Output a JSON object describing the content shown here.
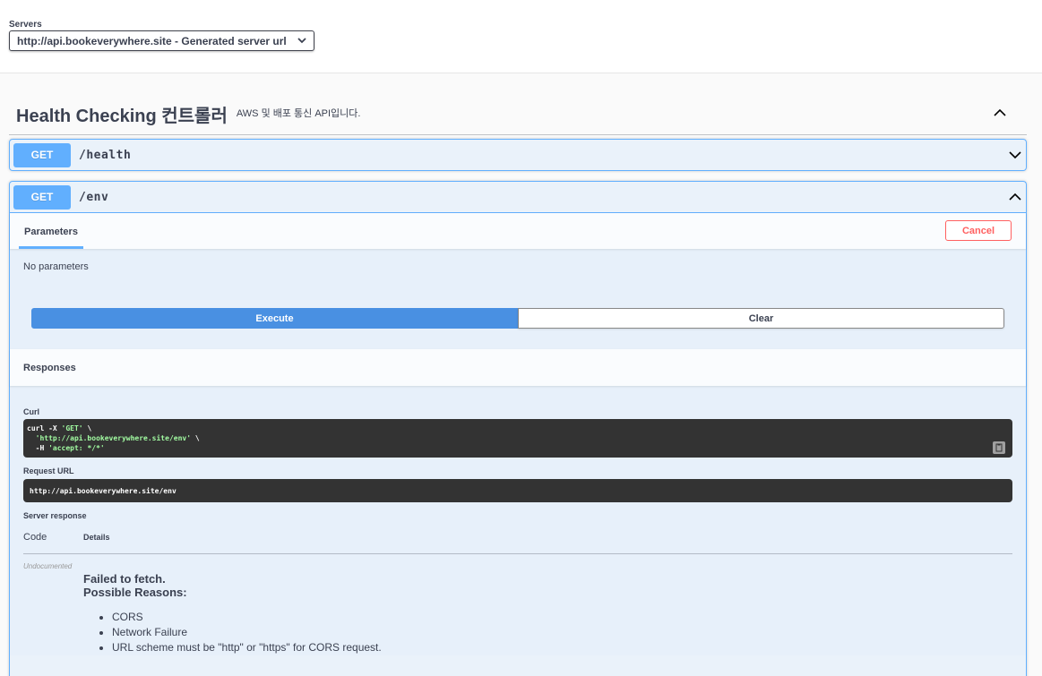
{
  "servers": {
    "label": "Servers",
    "selected": "http://api.bookeverywhere.site - Generated server url"
  },
  "tag": {
    "title": "Health Checking 컨트롤러",
    "description": "AWS 및 배포 통신 API입니다."
  },
  "operations": [
    {
      "method": "GET",
      "path": "/health",
      "expanded": false
    },
    {
      "method": "GET",
      "path": "/env",
      "expanded": true
    }
  ],
  "op_detail": {
    "parameters_tab": "Parameters",
    "cancel_label": "Cancel",
    "no_params": "No parameters",
    "execute_label": "Execute",
    "clear_label": "Clear",
    "responses_label": "Responses",
    "curl_label": "Curl",
    "curl_line1": "curl -X ",
    "curl_line1_str": "'GET'",
    "curl_line1_end": " \\",
    "curl_line2_str": "  'http://api.bookeverywhere.site/env'",
    "curl_line2_end": " \\",
    "curl_line3_flag": "  -H ",
    "curl_line3_str": "'accept: */*'",
    "request_url_label": "Request URL",
    "request_url": "http://api.bookeverywhere.site/env",
    "server_response_label": "Server response",
    "code_header": "Code",
    "details_header": "Details",
    "response_code": "Undocumented",
    "fail_title": "Failed to fetch.",
    "fail_subtitle": "Possible Reasons:",
    "reasons": [
      "CORS",
      "Network Failure",
      "URL scheme must be \"http\" or \"https\" for CORS request."
    ]
  },
  "colors": {
    "get": "#61affe",
    "execute": "#4990e2",
    "cancel": "#ff6060",
    "code_bg": "#333333"
  }
}
